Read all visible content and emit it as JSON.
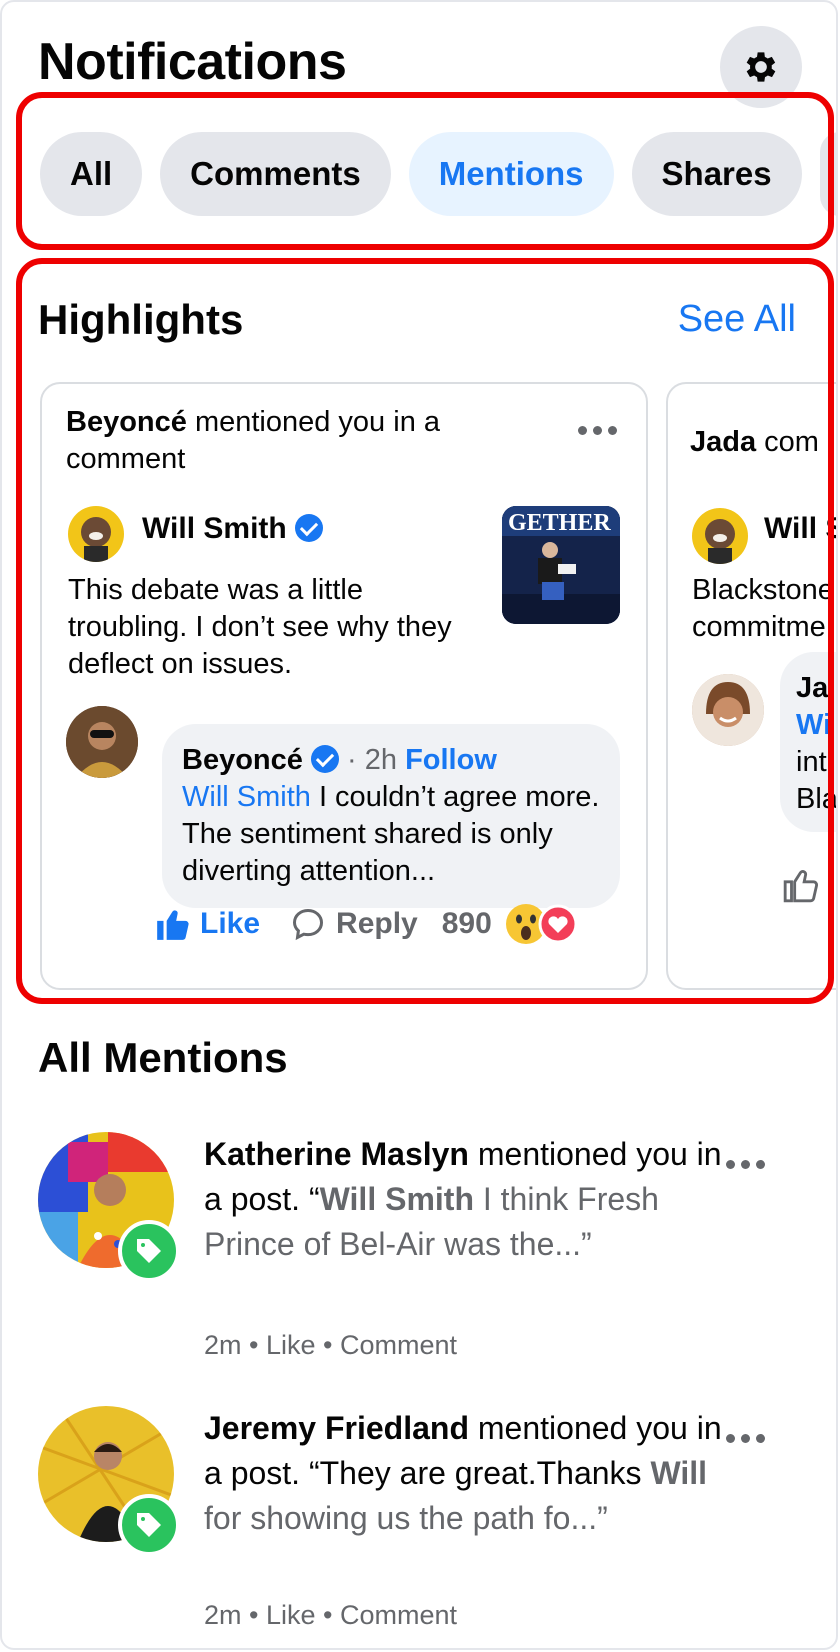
{
  "header": {
    "title": "Notifications",
    "settings_icon": "gear-icon"
  },
  "tabs": [
    {
      "label": "All",
      "active": false
    },
    {
      "label": "Comments",
      "active": false
    },
    {
      "label": "Mentions",
      "active": true
    },
    {
      "label": "Shares",
      "active": false
    }
  ],
  "highlights": {
    "title": "Highlights",
    "see_all": "See All",
    "card1": {
      "head_name": "Beyoncé",
      "head_text": " mentioned you in a comment",
      "post_author": "Will Smith",
      "post_text": "This debate was a little troubling. I don’t see why they deflect on issues.",
      "reply_author": "Beyoncé",
      "reply_time": "· 2h",
      "reply_follow": "Follow",
      "reply_mention": "Will Smith",
      "reply_text": " I couldn’t agree more. The sentiment shared is only diverting attention...",
      "like_label": "Like",
      "reply_label": "Reply",
      "reaction_count": "890"
    },
    "card2": {
      "head_name": "Jada",
      "head_text": " com",
      "post_author": "Will S",
      "post_text_1": "Blackstone",
      "post_text_2": "commitme",
      "reply_author": "Ja",
      "reply_mention": "Wi",
      "reply_line_3": "int",
      "reply_line_4": "Bla"
    }
  },
  "mentions": {
    "title": "All Mentions",
    "items": [
      {
        "name": "Katherine Maslyn",
        "action": " mentioned you in a post. “",
        "mention": "Will Smith",
        "snippet": " I think Fresh Prince of Bel-Air was the...”",
        "meta": "2m • Like • Comment"
      },
      {
        "name": "Jeremy Friedland",
        "action": " mentioned you in a post. “They are great.Thanks ",
        "mention": "Will",
        "snippet": " for showing us the path fo...”",
        "meta": "2m • Like • Comment"
      }
    ]
  },
  "colors": {
    "accent": "#1877f2",
    "annotation": "#ee0000",
    "tag_badge": "#2ac35e"
  }
}
